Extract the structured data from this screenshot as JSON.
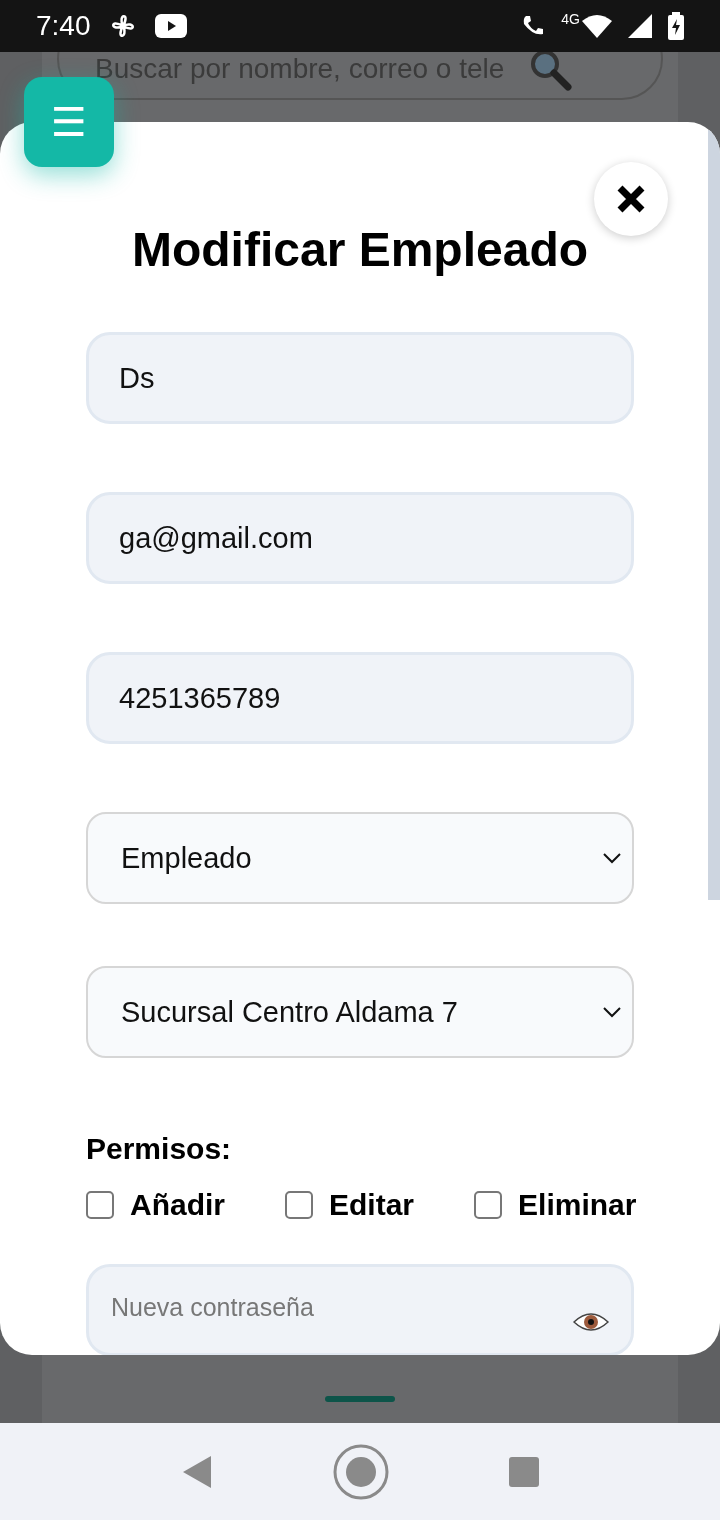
{
  "status_bar": {
    "time": "7:40",
    "network": "4G"
  },
  "background": {
    "search_placeholder": "Buscar por nombre, correo o tele"
  },
  "menu_button": {
    "label": "☰"
  },
  "modal": {
    "title": "Modificar Empleado",
    "fields": [
      {
        "kind": "input",
        "value": "Ds"
      },
      {
        "kind": "input",
        "value": "ga@gmail.com"
      },
      {
        "kind": "input",
        "value": "4251365789"
      },
      {
        "kind": "select",
        "value": "Empleado"
      },
      {
        "kind": "select",
        "value": "Sucursal Centro Aldama 7"
      }
    ],
    "permissions": {
      "label": "Permisos:",
      "options": [
        {
          "label": "Añadir",
          "checked": false
        },
        {
          "label": "Editar",
          "checked": false
        },
        {
          "label": "Eliminar",
          "checked": false
        }
      ]
    },
    "password": {
      "placeholder": "Nueva contraseña"
    }
  }
}
